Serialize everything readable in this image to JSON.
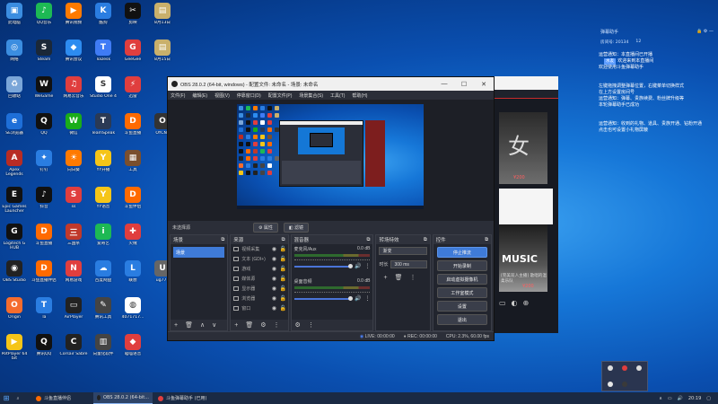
{
  "desktop_icons": [
    {
      "label": "此电脑",
      "color": "#3b8de0",
      "glyph": "▣"
    },
    {
      "label": "QQ音乐",
      "color": "#1db954",
      "glyph": "♪"
    },
    {
      "label": "腾讯视频",
      "color": "#ff7a00",
      "glyph": "▶"
    },
    {
      "label": "酷狗",
      "color": "#2a7de1",
      "glyph": "K"
    },
    {
      "label": "剪映",
      "color": "#111",
      "glyph": "✂"
    },
    {
      "label": "8月13日",
      "color": "#c9b06b",
      "glyph": "▤"
    },
    {
      "label": "网络",
      "color": "#3b8de0",
      "glyph": "◎"
    },
    {
      "label": "Steam",
      "color": "#1b2838",
      "glyph": "S"
    },
    {
      "label": "腾讯会议",
      "color": "#2d8cf0",
      "glyph": "◆"
    },
    {
      "label": "ToDesk",
      "color": "#3f7bf5",
      "glyph": "T"
    },
    {
      "label": "GeeGee",
      "color": "#e03e3e",
      "glyph": "G"
    },
    {
      "label": "8月15日",
      "color": "#c9b06b",
      "glyph": "▤"
    },
    {
      "label": "回收站",
      "color": "#7aa6d8",
      "glyph": "♻"
    },
    {
      "label": "WeGame",
      "color": "#111",
      "glyph": "W"
    },
    {
      "label": "网易云音乐",
      "color": "#e03e3e",
      "glyph": "♫"
    },
    {
      "label": "Studio One 4",
      "color": "#fff",
      "glyph": "S"
    },
    {
      "label": "迅雷",
      "color": "#e03e3e",
      "glyph": "⚡"
    },
    {
      "label": "",
      "color": "transparent",
      "glyph": ""
    },
    {
      "label": "SE浏览器",
      "color": "#1e6fd8",
      "glyph": "e"
    },
    {
      "label": "QQ",
      "color": "#111",
      "glyph": "Q"
    },
    {
      "label": "微信",
      "color": "#1aad19",
      "glyph": "W"
    },
    {
      "label": "TeamSpeak",
      "color": "#2b3a55",
      "glyph": "T"
    },
    {
      "label": "斗鱼直播",
      "color": "#ff6a00",
      "glyph": "D"
    },
    {
      "label": "OYCNT",
      "color": "#333",
      "glyph": "O"
    },
    {
      "label": "Apex Legends",
      "color": "#b82c24",
      "glyph": "A"
    },
    {
      "label": "钉钉",
      "color": "#2a7de1",
      "glyph": "✦"
    },
    {
      "label": "向日葵",
      "color": "#ff7a00",
      "glyph": "☀"
    },
    {
      "label": "YY开播",
      "color": "#f5c518",
      "glyph": "Y"
    },
    {
      "label": "工具",
      "color": "#7a4f2e",
      "glyph": "▦"
    },
    {
      "label": "",
      "color": "transparent",
      "glyph": ""
    },
    {
      "label": "Epic Games Launcher",
      "color": "#111",
      "glyph": "E"
    },
    {
      "label": "抖音",
      "color": "#111",
      "glyph": "♪"
    },
    {
      "label": "ss",
      "color": "#e03e3e",
      "glyph": "S"
    },
    {
      "label": "YY语音",
      "color": "#f5c518",
      "glyph": "Y"
    },
    {
      "label": "斗鱼伴侣",
      "color": "#ff6a00",
      "glyph": "D"
    },
    {
      "label": "",
      "color": "transparent",
      "glyph": ""
    },
    {
      "label": "Logitech G HUB",
      "color": "#111",
      "glyph": "G"
    },
    {
      "label": "斗鱼直播",
      "color": "#ff6a00",
      "glyph": "D"
    },
    {
      "label": "三国杀",
      "color": "#c0392b",
      "glyph": "三"
    },
    {
      "label": "爱奇艺",
      "color": "#1db954",
      "glyph": "i"
    },
    {
      "label": "火绒",
      "color": "#e03e3e",
      "glyph": "✚"
    },
    {
      "label": "",
      "color": "transparent",
      "glyph": ""
    },
    {
      "label": "OBS Studio",
      "color": "#222",
      "glyph": "◉"
    },
    {
      "label": "斗鱼直播伴侣",
      "color": "#ff6a00",
      "glyph": "D"
    },
    {
      "label": "网易游戏",
      "color": "#e03e3e",
      "glyph": "N"
    },
    {
      "label": "百度网盘",
      "color": "#2a7de1",
      "glyph": "☁"
    },
    {
      "label": "联想",
      "color": "#2a7de1",
      "glyph": "L"
    },
    {
      "label": "ug777",
      "color": "#666",
      "glyph": "U"
    },
    {
      "label": "Origin",
      "color": "#f56c2d",
      "glyph": "O"
    },
    {
      "label": "Ta",
      "color": "#2a7de1",
      "glyph": "T"
    },
    {
      "label": "AirPlayer",
      "color": "#222",
      "glyph": "▭"
    },
    {
      "label": "腾讯工具",
      "color": "#444",
      "glyph": "✎"
    },
    {
      "label": "4071717...",
      "color": "#fff",
      "glyph": "◍"
    },
    {
      "label": "",
      "color": "transparent",
      "glyph": ""
    },
    {
      "label": "PotPlayer 64 bit",
      "color": "#f5c518",
      "glyph": "▶"
    },
    {
      "label": "腾讯QQ",
      "color": "#111",
      "glyph": "Q"
    },
    {
      "label": "Corsair Sabre",
      "color": "#222",
      "glyph": "C"
    },
    {
      "label": "向量化软件",
      "color": "#444",
      "glyph": "▥"
    },
    {
      "label": "喵喵语音",
      "color": "#e03e3e",
      "glyph": "◆"
    }
  ],
  "obs": {
    "title": "OBS 28.0.2 (64-bit, windows) - 配置文件: 未命名 - 场景: 未命名",
    "menu": [
      "文件(F)",
      "编辑(E)",
      "视图(V)",
      "停靠窗口(D)",
      "配置文件(P)",
      "场景集合(S)",
      "工具(T)",
      "帮助(H)"
    ],
    "scene_label": "未选择源",
    "scene_btn_props": "属性",
    "scene_btn_filters": "滤镜",
    "docks": {
      "scenes": {
        "title": "场景",
        "items": [
          "场景"
        ]
      },
      "sources": {
        "title": "来源",
        "items": [
          "视频采集",
          "文本 (GDI+)",
          "游戏",
          "媒体源",
          "显示器",
          "浏览器",
          "窗口"
        ]
      },
      "mixer": {
        "title": "混音器",
        "channels": [
          {
            "name": "麦克风/Aux",
            "db": "0.0 dB"
          },
          {
            "name": "桌面音频",
            "db": "0.0 dB"
          }
        ]
      },
      "transitions": {
        "title": "转场特效",
        "type": "渐变",
        "duration_label": "时长",
        "duration": "300 ms"
      },
      "controls": {
        "title": "控件",
        "buttons": [
          "停止推流",
          "开始录制",
          "启动虚拟摄像机",
          "工作室模式",
          "设置",
          "退出"
        ]
      }
    },
    "status": {
      "live": "LIVE: 00:00:00",
      "rec": "REC: 00:00:00",
      "cpu": "CPU: 2.3%, 60.00 fps"
    }
  },
  "douyu": {
    "card1_big": "女",
    "card1_price": "¥200",
    "card2_title": "MUSIC",
    "card2_sub": "[完美双人主播] 歌唱的温柔乐队",
    "card2_price": "¥200"
  },
  "chat": {
    "title": "弹幕助手",
    "room": "房间号: 20134",
    "count": "12",
    "lines": [
      {
        "text": "运营通知：本直播间已开播",
        "tag": ""
      },
      {
        "text": "欢迎来到本直播间",
        "tag": "水友"
      },
      {
        "text": "欢迎使用斗鱼弹幕助手",
        "tag": ""
      },
      {
        "text": "左键拖拽调整弹幕位置，右键菜单切换样式",
        "tag": ""
      },
      {
        "text": "在上方设置房间号",
        "tag": ""
      },
      {
        "text": "运营通知：弹幕、贵族续费、粉丝牌升级等",
        "tag": ""
      },
      {
        "text": "本轮弹幕助手已成功",
        "tag": ""
      },
      {
        "text": "运营通知：收到的礼物、道具、贵族开通、钻粉开通",
        "tag": ""
      },
      {
        "text": "点击也可设置小礼物屏蔽",
        "tag": ""
      }
    ]
  },
  "taskbar": {
    "tasks": [
      {
        "label": "斗鱼直播伴侣",
        "color": "#ff6a00",
        "active": false
      },
      {
        "label": "OBS 28.0.2 (64-bit...",
        "color": "#222",
        "active": true
      },
      {
        "label": "斗鱼弹幕助手 (已用)",
        "color": "#e03e3e",
        "active": false
      }
    ],
    "time": "20:19"
  }
}
